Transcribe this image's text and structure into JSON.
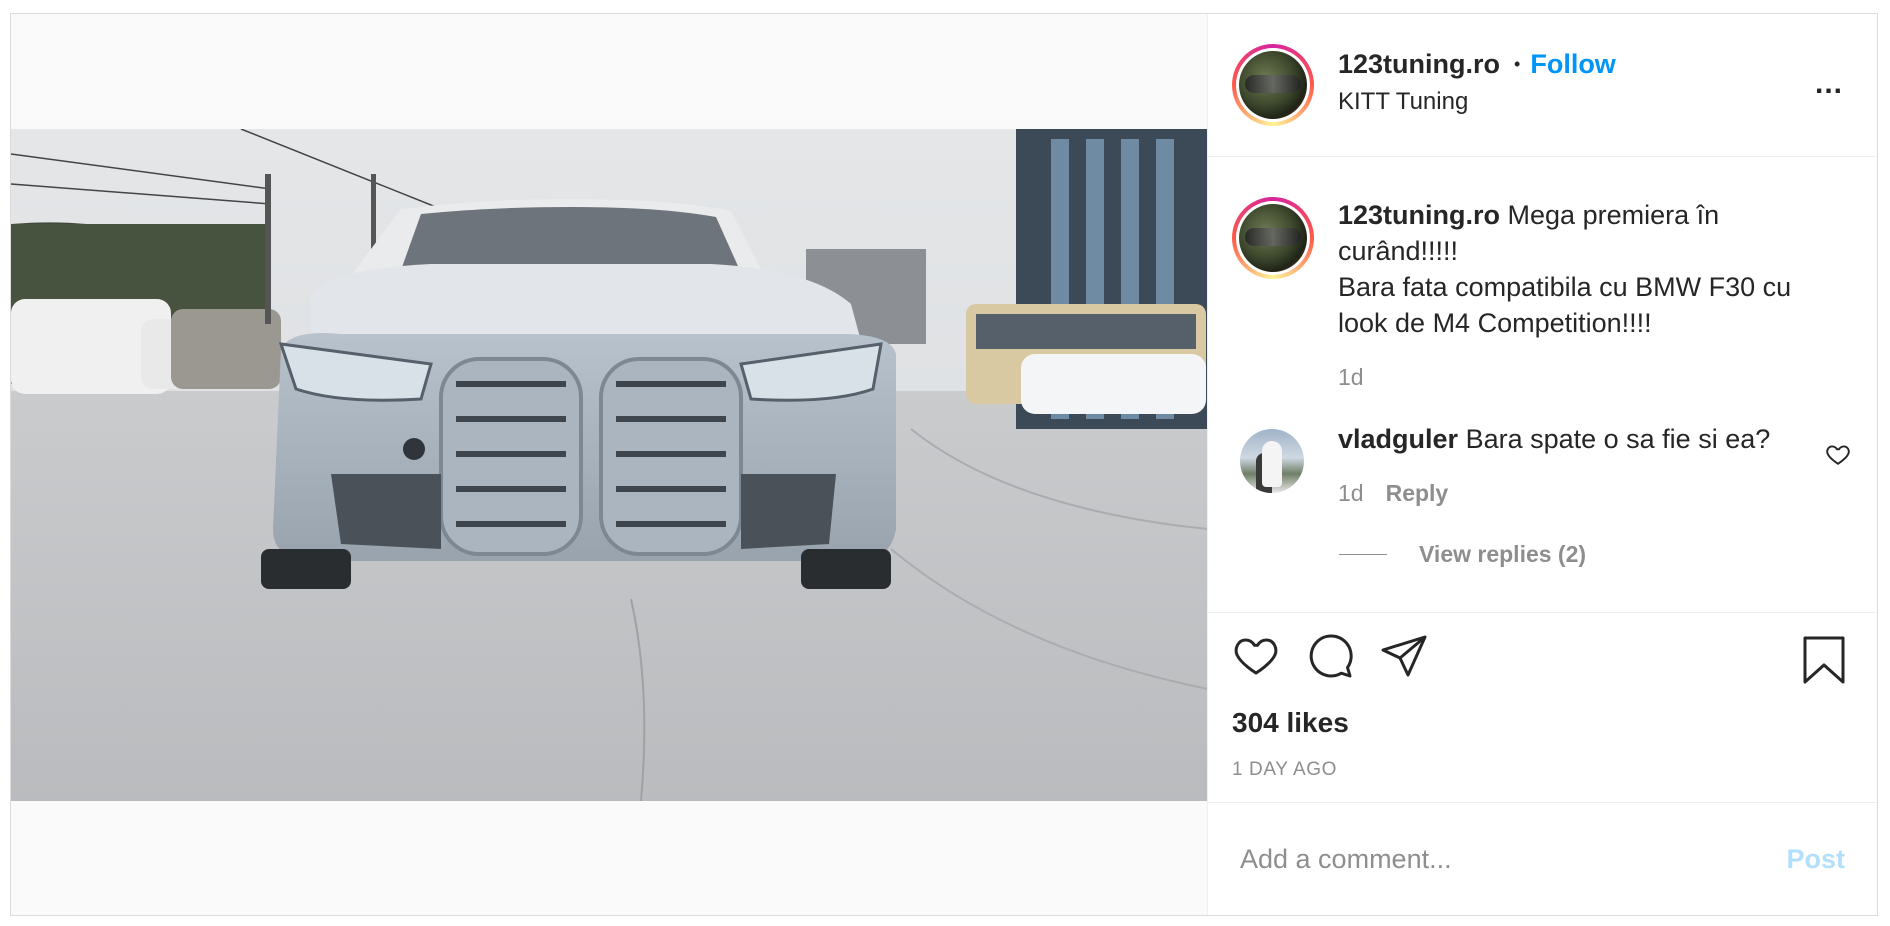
{
  "post": {
    "author": "123tuning.ro",
    "follow_label": "Follow",
    "dot": "•",
    "location": "KITT Tuning",
    "more": "..."
  },
  "caption": {
    "user": "123tuning.ro",
    "text_line1": "Mega premiera în curând!!!!!",
    "text_line2": "Bara fata compatibila cu BMW F30 cu look de M4 Competition!!!!",
    "time": "1d"
  },
  "comments": [
    {
      "user": "vladguler",
      "text": "Bara spate o sa fie si ea?",
      "time": "1d",
      "reply_label": "Reply",
      "view_replies": "View replies (2)"
    }
  ],
  "stats": {
    "likes": "304 likes",
    "time_ago": "1 DAY AGO"
  },
  "composer": {
    "placeholder": "Add a comment...",
    "post_label": "Post"
  },
  "colors": {
    "accent": "#0095f6",
    "muted": "#8e8e8e",
    "post_disabled": "#b2dffc"
  },
  "icons": [
    "heart-icon",
    "comment-icon",
    "share-icon",
    "bookmark-icon",
    "more-icon"
  ]
}
